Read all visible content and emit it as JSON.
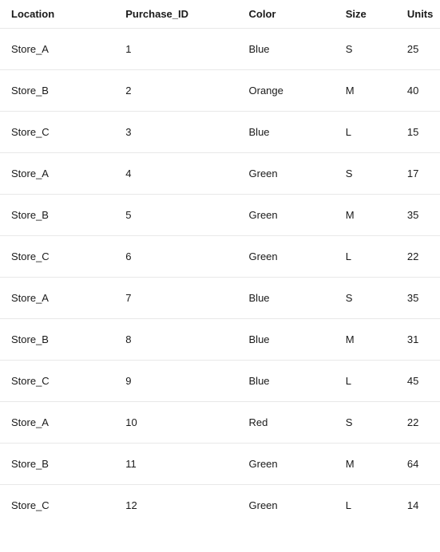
{
  "table": {
    "headers": {
      "location": "Location",
      "purchase_id": "Purchase_ID",
      "color": "Color",
      "size": "Size",
      "units": "Units"
    },
    "rows": [
      {
        "location": "Store_A",
        "purchase_id": "1",
        "color": "Blue",
        "size": "S",
        "units": "25"
      },
      {
        "location": "Store_B",
        "purchase_id": "2",
        "color": "Orange",
        "size": "M",
        "units": "40"
      },
      {
        "location": "Store_C",
        "purchase_id": "3",
        "color": "Blue",
        "size": "L",
        "units": "15"
      },
      {
        "location": "Store_A",
        "purchase_id": "4",
        "color": "Green",
        "size": "S",
        "units": "17"
      },
      {
        "location": "Store_B",
        "purchase_id": "5",
        "color": "Green",
        "size": "M",
        "units": "35"
      },
      {
        "location": "Store_C",
        "purchase_id": "6",
        "color": "Green",
        "size": "L",
        "units": "22"
      },
      {
        "location": "Store_A",
        "purchase_id": "7",
        "color": "Blue",
        "size": "S",
        "units": "35"
      },
      {
        "location": "Store_B",
        "purchase_id": "8",
        "color": "Blue",
        "size": "M",
        "units": "31"
      },
      {
        "location": "Store_C",
        "purchase_id": "9",
        "color": "Blue",
        "size": "L",
        "units": "45"
      },
      {
        "location": "Store_A",
        "purchase_id": "10",
        "color": "Red",
        "size": "S",
        "units": "22"
      },
      {
        "location": "Store_B",
        "purchase_id": "11",
        "color": "Green",
        "size": "M",
        "units": "64"
      },
      {
        "location": "Store_C",
        "purchase_id": "12",
        "color": "Green",
        "size": "L",
        "units": "14"
      }
    ]
  }
}
